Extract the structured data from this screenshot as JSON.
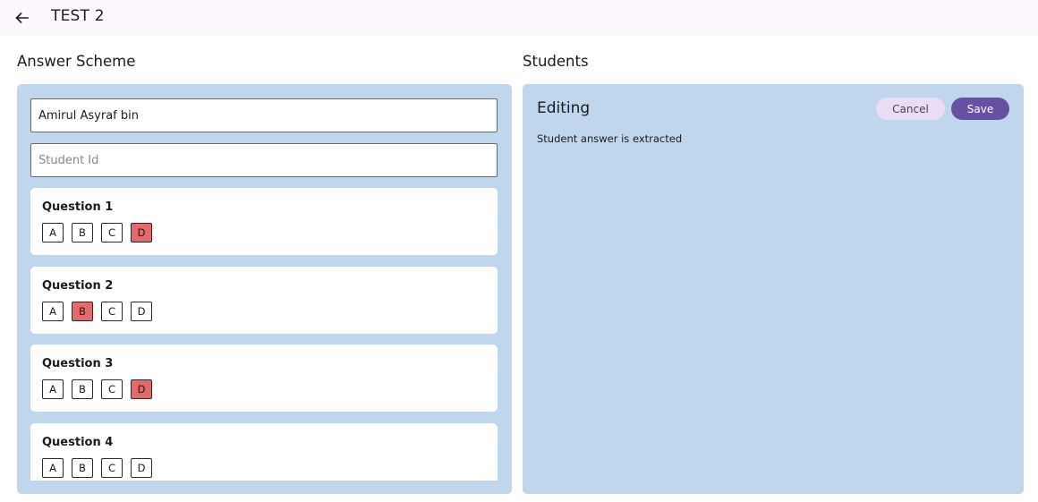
{
  "appbar": {
    "title": "TEST 2",
    "back_icon": "arrow-left-icon"
  },
  "answer_scheme": {
    "title": "Answer Scheme",
    "student_name_value": "Amirul Asyraf bin",
    "student_id_placeholder": "Student Id",
    "questions": [
      {
        "label": "Question 1",
        "options": [
          "A",
          "B",
          "C",
          "D"
        ],
        "selected": "D"
      },
      {
        "label": "Question 2",
        "options": [
          "A",
          "B",
          "C",
          "D"
        ],
        "selected": "B"
      },
      {
        "label": "Question 3",
        "options": [
          "A",
          "B",
          "C",
          "D"
        ],
        "selected": "D"
      },
      {
        "label": "Question 4",
        "options": [
          "A",
          "B",
          "C",
          "D"
        ],
        "selected": ""
      }
    ]
  },
  "students": {
    "title": "Students",
    "editing_label": "Editing",
    "cancel_label": "Cancel",
    "save_label": "Save",
    "status": "Student answer is extracted"
  },
  "colors": {
    "selected_option": "#e26a6a",
    "panel_bg": "#c0d6ec",
    "save_button": "#6750a4",
    "cancel_button": "#e9ddf6"
  }
}
